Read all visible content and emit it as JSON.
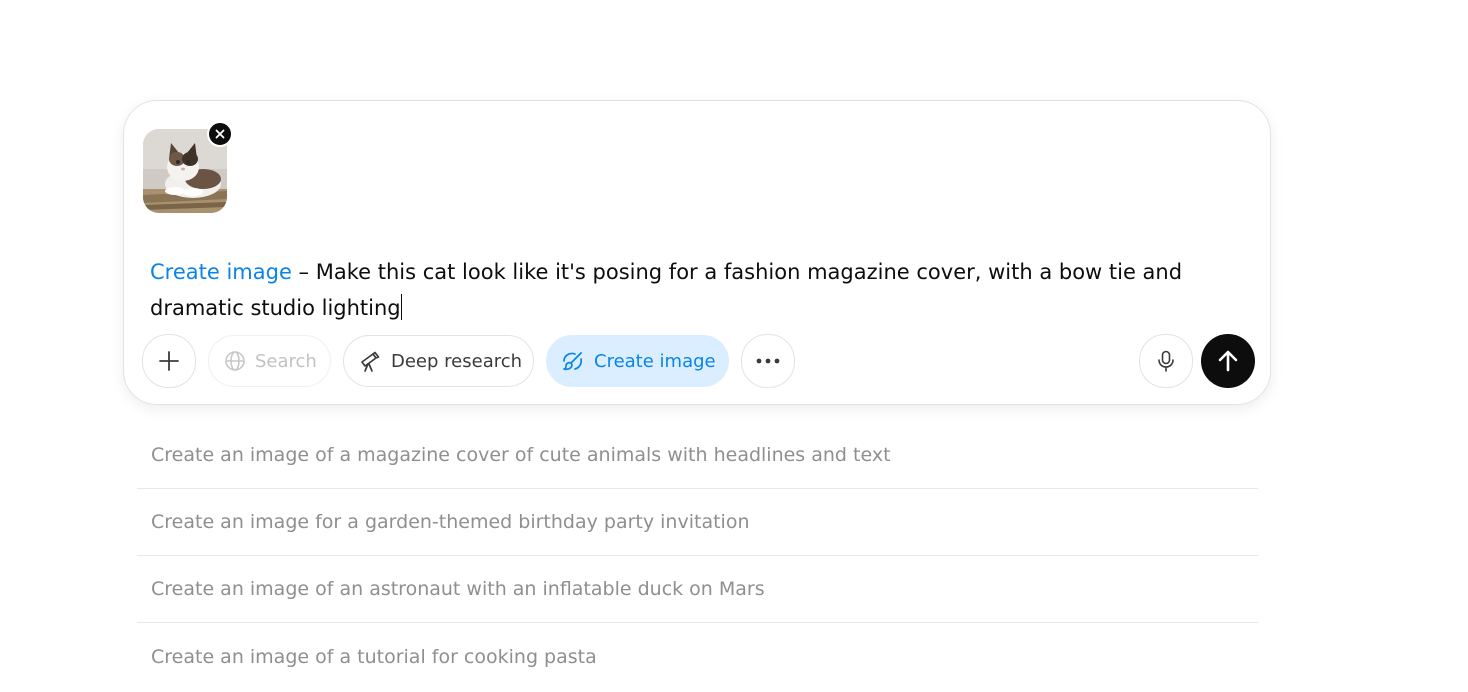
{
  "composer": {
    "attachment": {
      "icon": "cat-photo-thumbnail",
      "remove_icon": "close-icon"
    },
    "prompt": {
      "tool_tag": "Create image",
      "text": " – Make this cat look like it's posing for a fashion magazine cover, with a bow tie and dramatic studio lighting"
    },
    "toolbar": {
      "add_icon": "plus-icon",
      "search_label": "Search",
      "search_icon": "globe-icon",
      "deep_research_label": "Deep research",
      "deep_research_icon": "telescope-icon",
      "create_image_label": "Create image",
      "create_image_icon": "brush-icon",
      "more_icon": "more-horizontal-icon",
      "mic_icon": "microphone-icon",
      "send_icon": "arrow-up-icon"
    }
  },
  "suggestions": [
    "Create an image of a magazine cover of cute animals with headlines and text",
    "Create an image for a garden-themed birthday party invitation",
    "Create an image of an astronaut with an inflatable duck on Mars",
    "Create an image of a tutorial for cooking pasta"
  ],
  "colors": {
    "accent": "#0a84e8",
    "accent_bg": "#daeeff",
    "send_bg": "#0d0d0d",
    "suggestion_text": "#8f8f8f"
  }
}
